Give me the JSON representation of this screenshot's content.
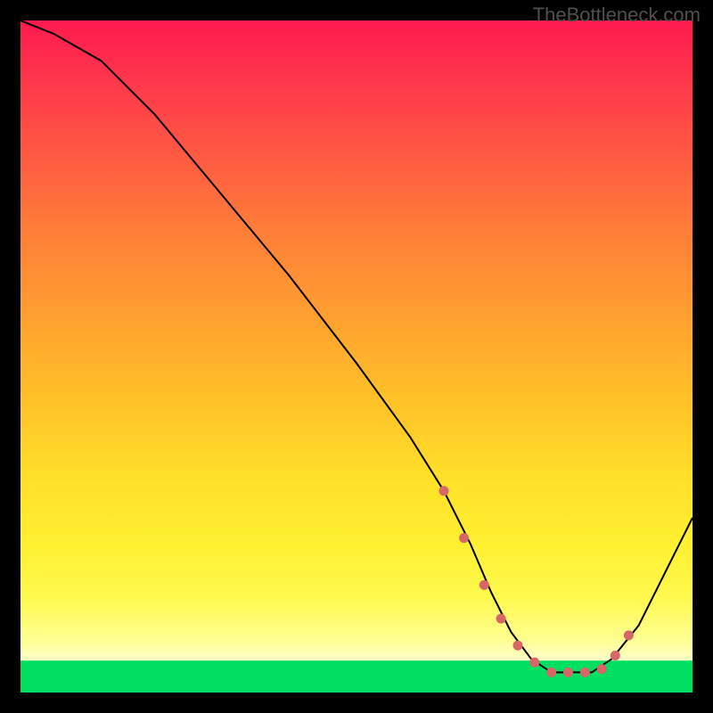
{
  "watermark": "TheBottleneck.com",
  "chart_data": {
    "type": "line",
    "title": "",
    "xlabel": "",
    "ylabel": "",
    "xlim": [
      0,
      100
    ],
    "ylim": [
      0,
      100
    ],
    "series": [
      {
        "name": "curve",
        "x": [
          0,
          5,
          12,
          20,
          30,
          40,
          50,
          58,
          63,
          67,
          70,
          73,
          76,
          79,
          82,
          85,
          88,
          92,
          96,
          100
        ],
        "values": [
          100,
          98,
          94,
          86,
          74,
          62,
          49,
          38,
          30,
          22,
          15,
          9,
          5,
          3,
          3,
          3,
          5,
          10,
          18,
          26
        ]
      }
    ],
    "markers": {
      "name": "highlight",
      "x": [
        63,
        66,
        69,
        71.5,
        74,
        76.5,
        79,
        81.5,
        84,
        86.5,
        88.5,
        90.5
      ],
      "values": [
        30,
        23,
        16,
        11,
        7,
        4.5,
        3,
        3,
        3,
        3.5,
        5.5,
        8.5
      ]
    },
    "colors": {
      "curve": "#000000",
      "markers": "#d96666",
      "gradient_top": "#ff1a4f",
      "gradient_mid": "#ffe028",
      "gradient_bottom": "#00e060"
    }
  }
}
